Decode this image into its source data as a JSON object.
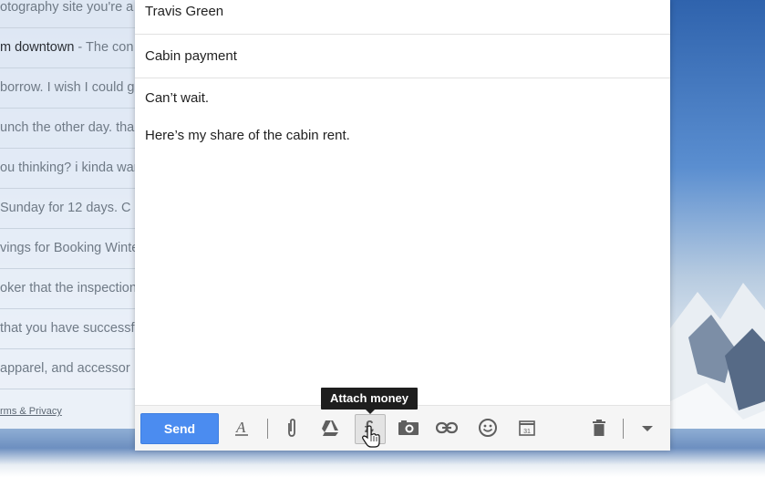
{
  "inbox": {
    "rows": [
      {
        "text": "otography site you're a",
        "bold": false
      },
      {
        "text": "m downtown",
        "bold": true,
        "snippet": " - The con"
      },
      {
        "text": "borrow. I wish I could g",
        "bold": false
      },
      {
        "text": "unch the other day. thar",
        "bold": false
      },
      {
        "text": "ou thinking? i kinda war",
        "bold": false
      },
      {
        "text": " Sunday for 12 days. C",
        "bold": false
      },
      {
        "text": "vings for Booking Winte",
        "bold": false
      },
      {
        "text": "oker that the inspection",
        "bold": false
      },
      {
        "text": "that you have successf",
        "bold": false
      },
      {
        "text": " apparel, and accessor",
        "bold": false
      }
    ],
    "footer": "rms & Privacy"
  },
  "compose": {
    "to": "Travis Green",
    "subject": "Cabin payment",
    "body_line1": "Can’t wait.",
    "body_line2": "Here’s my share of the cabin rent."
  },
  "toolbar": {
    "send_label": "Send",
    "tooltip": "Attach money",
    "calendar_day": "31",
    "icons": [
      "format-text-icon",
      "attach-file-icon",
      "google-drive-icon",
      "attach-money-icon",
      "insert-photo-icon",
      "insert-link-icon",
      "emoji-icon",
      "calendar-icon",
      "trash-icon",
      "more-options-icon"
    ]
  },
  "colors": {
    "send_button": "#4b8cf0",
    "tooltip_bg": "#1e1e1e"
  }
}
